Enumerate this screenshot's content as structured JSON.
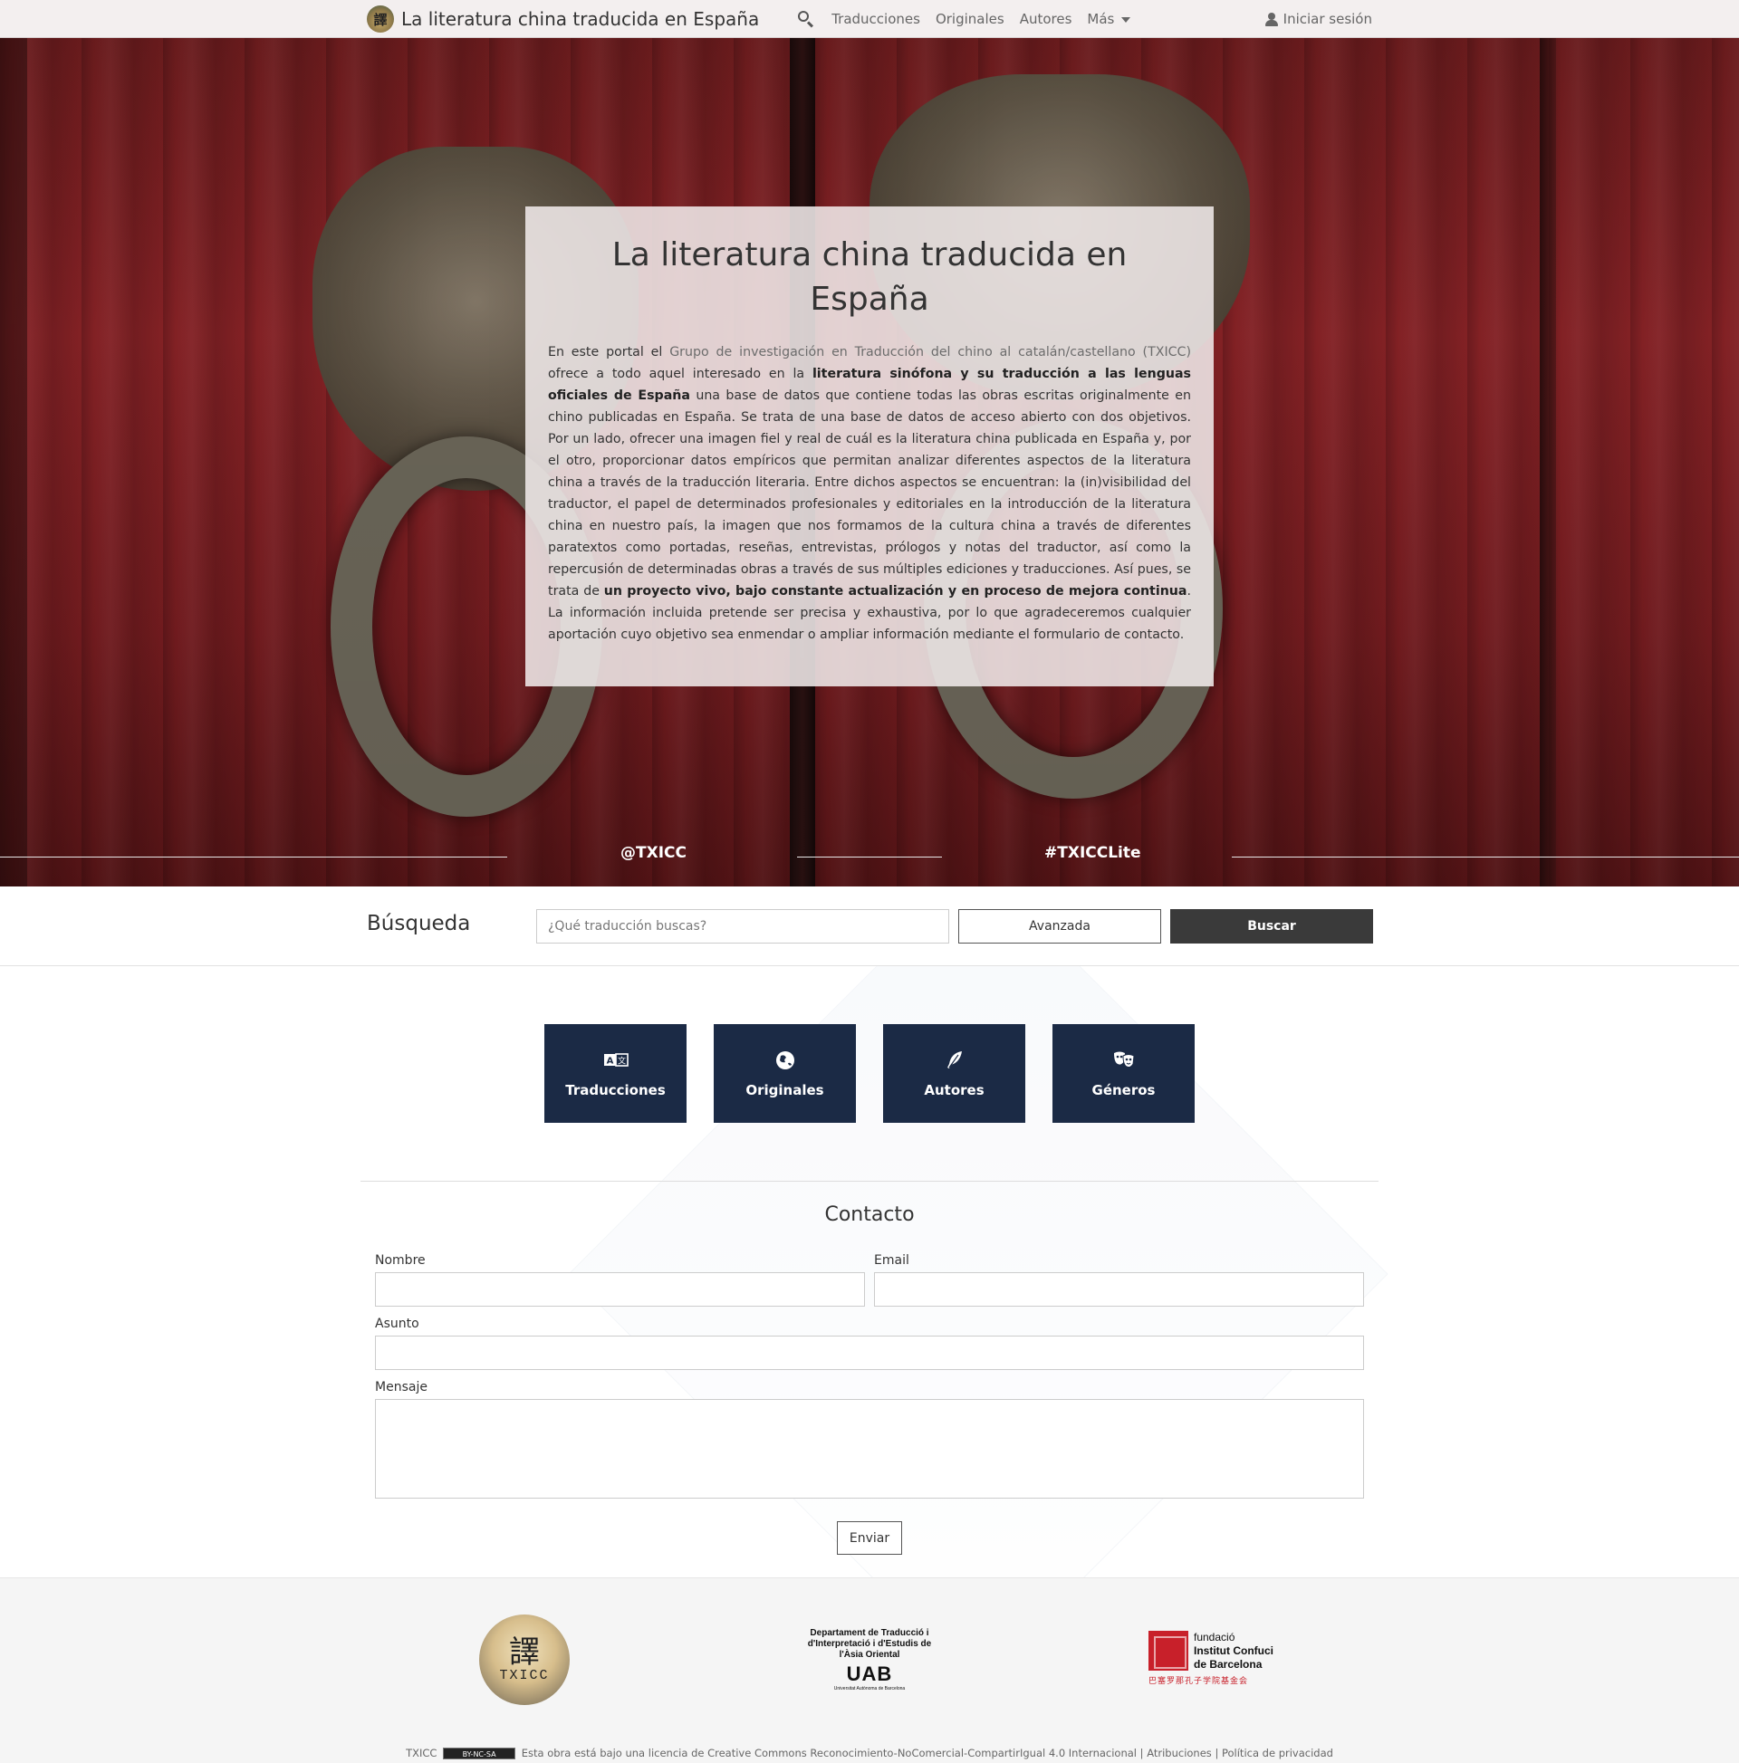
{
  "navbar": {
    "brand": "La literatura china traducida en España",
    "logo_glyph": "譯",
    "links": [
      "Traducciones",
      "Originales",
      "Autores",
      "Más"
    ],
    "login": "Iniciar sesión"
  },
  "hero": {
    "title": "La literatura china traducida en España",
    "paragraph": {
      "p1": "En este portal el ",
      "group": "Grupo de investigación en Traducción del chino al catalán/castellano (TXICC)",
      "p2": " ofrece a todo aquel interesado en la ",
      "bold1": "literatura sinófona y su traducción a las lenguas oficiales de España",
      "p3": " una base de datos que contiene todas las obras escritas originalmente en chino publicadas en España. Se trata de una base de datos de acceso abierto con dos objetivos. Por un lado, ofrecer una imagen fiel y real de cuál es la literatura china publicada en España y, por el otro, proporcionar datos empíricos que permitan analizar diferentes aspectos de la literatura china a través de la traducción literaria. Entre dichos aspectos se encuentran: la (in)visibilidad del traductor, el papel de determinados profesionales y editoriales en la introducción de la literatura china en nuestro país, la imagen que nos formamos de la cultura china a través de diferentes paratextos como portadas, reseñas, entrevistas, prólogos y notas del traductor, así como la repercusión de determinadas obras a través de sus múltiples ediciones y traducciones. Así pues, se trata de ",
      "bold2": "un proyecto vivo, bajo constante actualización y en proceso de mejora continua",
      "p4": ". La información incluida pretende ser precisa y exhaustiva, por lo que agradeceremos cualquier aportación cuyo objetivo sea enmendar o ampliar información mediante el formulario de contacto."
    },
    "social": [
      "@TXICC",
      "#TXICCLite"
    ]
  },
  "search": {
    "title": "Búsqueda",
    "placeholder": "¿Qué traducción buscas?",
    "advanced": "Avanzada",
    "submit": "Buscar"
  },
  "categories": [
    {
      "label": "Traducciones",
      "icon": "translate-icon"
    },
    {
      "label": "Originales",
      "icon": "globe-asia-icon"
    },
    {
      "label": "Autores",
      "icon": "feather-icon"
    },
    {
      "label": "Géneros",
      "icon": "theater-masks-icon"
    }
  ],
  "contact": {
    "title": "Contacto",
    "name_label": "Nombre",
    "email_label": "Email",
    "subject_label": "Asunto",
    "message_label": "Mensaje",
    "send": "Enviar"
  },
  "footer": {
    "txicc_logo_text": "TXICC",
    "txicc_glyph": "譯",
    "uab_dept": "Departament de Traducció i d'Interpretació i d'Estudis de l'Àsia Oriental",
    "uab_mark": "UAB",
    "uab_university": "Universitat Autònoma de Barcelona",
    "ic_text_1": "fundació",
    "ic_text_2": "Institut Confuci",
    "ic_text_3": "de Barcelona",
    "ic_chinese": "巴塞罗那孔子学院基金会",
    "license_prefix": "TXICC",
    "cc_badge": "BY-NC-SA",
    "license_mid": " Esta obra está bajo una ",
    "license_link": "licencia de Creative Commons Reconocimiento-NoComercial-CompartirIgual 4.0 Internacional",
    "sep": " | ",
    "attributions": "Atribuciones",
    "privacy": "Política de privacidad"
  }
}
